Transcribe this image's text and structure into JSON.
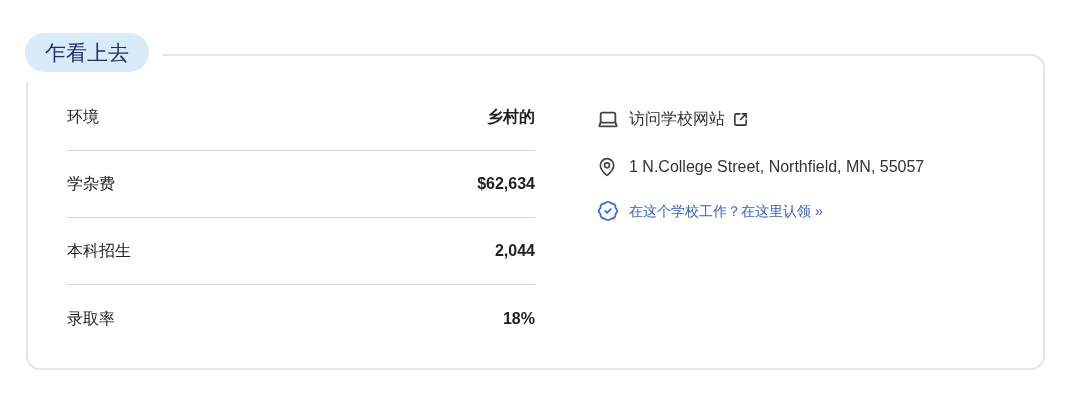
{
  "section": {
    "title": "乍看上去"
  },
  "facts": [
    {
      "label": "环境",
      "value": "乡村的"
    },
    {
      "label": "学杂费",
      "value": "$62,634"
    },
    {
      "label": "本科招生",
      "value": "2,044"
    },
    {
      "label": "录取率",
      "value": "18%"
    }
  ],
  "links": {
    "website": "访问学校网站",
    "address": "1 N.College Street, Northfield, MN, 55057",
    "claim": "在这个学校工作？在这里认领 »"
  }
}
